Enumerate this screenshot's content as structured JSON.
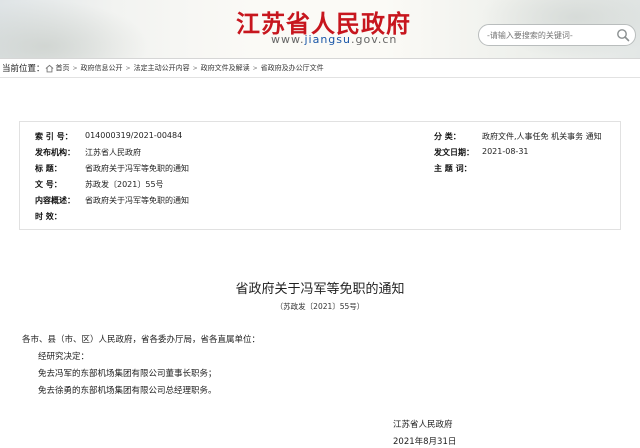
{
  "header": {
    "site_title": "江苏省人民政府",
    "url_prefix": "www.",
    "url_domain": "jiangsu",
    "url_suffix": ".gov.cn",
    "search_placeholder": "-请输入要搜索的关键词-",
    "accent_color": "#c7161e"
  },
  "breadcrumb": {
    "label": "当前位置：",
    "items": [
      "首页",
      "政府信息公开",
      "法定主动公开内容",
      "政府文件及解读",
      "省政府及办公厅文件"
    ],
    "separator": ">"
  },
  "meta": {
    "index_label": "索  引  号：",
    "index_value": "014000319/2021-00484",
    "category_label": "分      类：",
    "category_value": "政府文件,人事任免 机关事务 通知",
    "issuer_label": "发布机构：",
    "issuer_value": "江苏省人民政府",
    "date_label": "发文日期：",
    "date_value": "2021-08-31",
    "title_label": "标      题：",
    "title_value": "省政府关于冯军等免职的通知",
    "topic_label": "主  题  词：",
    "topic_value": "",
    "docno_label": "文      号：",
    "docno_value": "苏政发〔2021〕55号",
    "summary_label": "内容概述：",
    "summary_value": "省政府关于冯军等免职的通知",
    "validity_label": "时      效：",
    "validity_value": ""
  },
  "article": {
    "title": "省政府关于冯军等免职的通知",
    "doc_number": "（苏政发〔2021〕55号）",
    "addressee": "各市、县（市、区）人民政府，省各委办厅局，省各直属单位：",
    "para1": "经研究决定：",
    "para2": "免去冯军的东部机场集团有限公司董事长职务；",
    "para3": "免去徐勇的东部机场集团有限公司总经理职务。",
    "signature": "江苏省人民政府",
    "sign_date": "2021年8月31日"
  }
}
